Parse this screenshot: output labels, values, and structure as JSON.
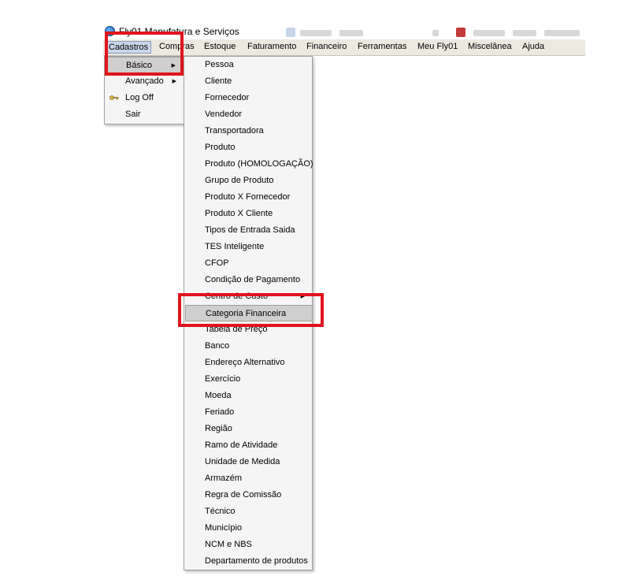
{
  "window": {
    "title": "Fly01 Manufatura e Serviços"
  },
  "menubar": {
    "items": [
      {
        "label": "Cadastros"
      },
      {
        "label": "Compras"
      },
      {
        "label": "Estoque"
      },
      {
        "label": "Faturamento"
      },
      {
        "label": "Financeiro"
      },
      {
        "label": "Ferramentas"
      },
      {
        "label": "Meu Fly01"
      },
      {
        "label": "Miscelânea"
      },
      {
        "label": "Ajuda"
      }
    ],
    "active": "Cadastros"
  },
  "cadastros_menu": {
    "items": [
      {
        "label": "Básico",
        "has_submenu": true,
        "highlighted": true
      },
      {
        "label": "Avançado",
        "has_submenu": true
      },
      {
        "label": "Log Off",
        "icon": "key-icon"
      },
      {
        "label": "Sair"
      }
    ]
  },
  "basico_menu": {
    "items": [
      {
        "label": "Pessoa"
      },
      {
        "label": "Cliente"
      },
      {
        "label": "Fornecedor"
      },
      {
        "label": "Vendedor"
      },
      {
        "label": "Transportadora"
      },
      {
        "label": "Produto"
      },
      {
        "label": "Produto (HOMOLOGAÇÃO)"
      },
      {
        "label": "Grupo de Produto"
      },
      {
        "label": "Produto X Fornecedor"
      },
      {
        "label": "Produto X Cliente"
      },
      {
        "label": "Tipos de Entrada Saida"
      },
      {
        "label": "TES Inteligente"
      },
      {
        "label": "CFOP"
      },
      {
        "label": "Condição de Pagamento"
      },
      {
        "label": "Centro de Custo",
        "has_submenu": true
      },
      {
        "label": "Categoria Financeira",
        "highlighted": true
      },
      {
        "label": "Tabela de Preço"
      },
      {
        "label": "Banco"
      },
      {
        "label": "Endereço Alternativo"
      },
      {
        "label": "Exercício"
      },
      {
        "label": "Moeda"
      },
      {
        "label": "Feriado"
      },
      {
        "label": "Região"
      },
      {
        "label": "Ramo de Atividade"
      },
      {
        "label": "Unidade de Medida"
      },
      {
        "label": "Armazém"
      },
      {
        "label": "Regra de Comissão"
      },
      {
        "label": "Técnico"
      },
      {
        "label": "Município"
      },
      {
        "label": "NCM e NBS"
      },
      {
        "label": "Departamento de produtos"
      }
    ]
  },
  "colors": {
    "highlight_box": "#e0141e",
    "menubar_bg": "#ece9e0",
    "menu_bg": "#f5f5f5",
    "hover_bg": "#cfcfcf"
  },
  "submenu_arrow": "▶"
}
